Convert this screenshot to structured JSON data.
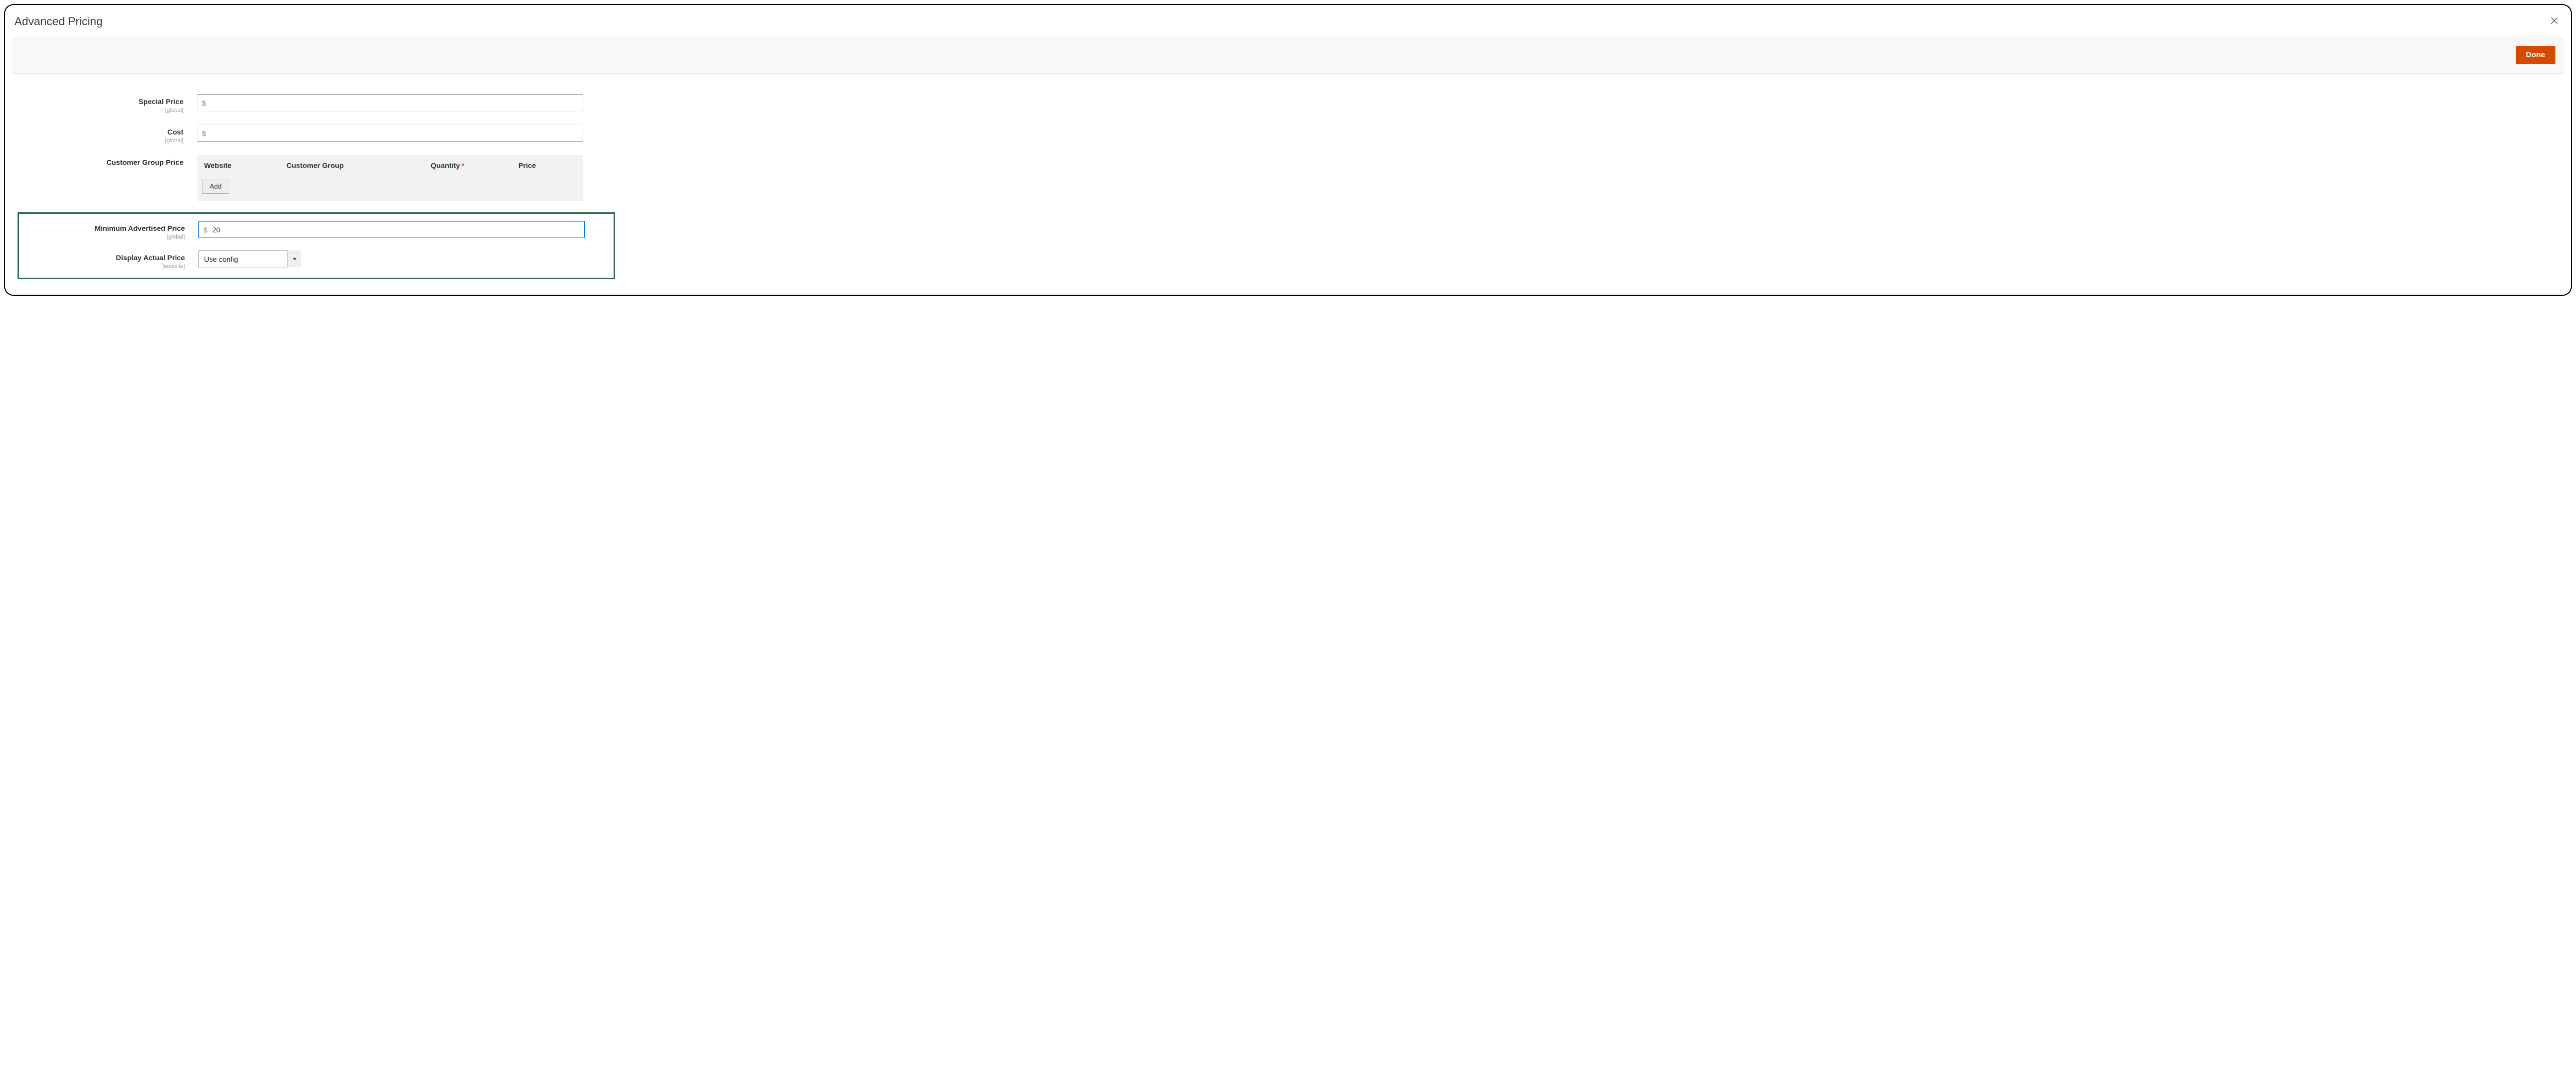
{
  "modal": {
    "title": "Advanced Pricing",
    "doneLabel": "Done"
  },
  "fields": {
    "specialPrice": {
      "label": "Special Price",
      "scope": "[global]",
      "prefix": "$",
      "value": ""
    },
    "cost": {
      "label": "Cost",
      "scope": "[global]",
      "prefix": "$",
      "value": ""
    },
    "customerGroupPrice": {
      "label": "Customer Group Price",
      "columns": {
        "website": "Website",
        "customerGroup": "Customer Group",
        "quantity": "Quantity",
        "price": "Price"
      },
      "addLabel": "Add"
    },
    "minAdvertisedPrice": {
      "label": "Minimum Advertised Price",
      "scope": "[global]",
      "prefix": "$",
      "value": "20"
    },
    "displayActualPrice": {
      "label": "Display Actual Price",
      "scope": "[website]",
      "selected": "Use config",
      "options": [
        "Use config"
      ]
    }
  }
}
